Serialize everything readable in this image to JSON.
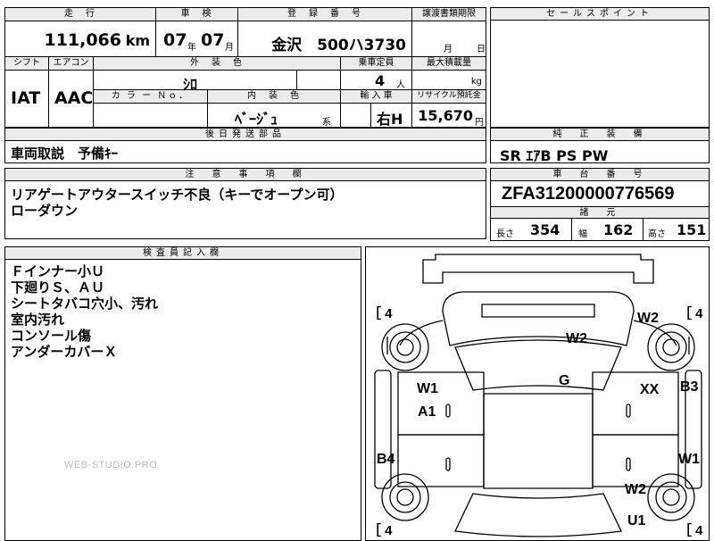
{
  "top_partial": "（上部切れ）",
  "spec": {
    "headers": {
      "mileage": "走　行",
      "inspection": "車　検",
      "registration": "登　録　番　号",
      "transfer_deadline": "譲渡書類期限",
      "shift": "シフト",
      "aircon": "エアコン",
      "exterior_color": "外　装　色",
      "capacity": "乗車定員",
      "max_load": "最大積載量",
      "color_no": "カ ラ ー Ｎｏ．",
      "interior_color": "内　装　色",
      "import": "輸 入 車",
      "recycle": "リサイクル預託金"
    },
    "mileage_value": "111,066",
    "mileage_unit": "km",
    "inspection_year": "07",
    "inspection_year_unit": "年",
    "inspection_month": "07",
    "inspection_month_unit": "月",
    "registration_value": "金沢　500ハ3730",
    "deadline_month_unit": "月",
    "deadline_day_unit": "日",
    "shift_value": "IAT",
    "aircon_value": "AAC",
    "exterior_color_value": "ｼﾛ",
    "capacity_value": "4",
    "capacity_unit": "人",
    "max_load_unit": "kg",
    "interior_color_value": "ﾍﾞｰｼﾞｭ",
    "interior_color_suffix": "系",
    "import_value": "右H",
    "recycle_value": "15,670",
    "recycle_unit": "円"
  },
  "sales_point": {
    "title": "セールスポイント"
  },
  "equipment": {
    "title": "純　正　装　備",
    "value": "SR  ｴｱB  PS  PW"
  },
  "later_parts": {
    "title": "後日発送部品",
    "value": "車両取説　予備ｷｰ"
  },
  "caution": {
    "title": "注　意　事　項　欄",
    "lines": [
      "リアゲートアウタースイッチ不良（キーでオープン可）",
      "ローダウン"
    ]
  },
  "chassis": {
    "title": "車　台　番　号",
    "value": "ZFA31200000776569"
  },
  "dimensions": {
    "title": "諸　元",
    "length_label": "長さ",
    "length_value": "354",
    "width_label": "幅",
    "width_value": "162",
    "height_label": "高さ",
    "height_value": "151"
  },
  "inspector": {
    "title": "検査員記入欄",
    "lines": [
      "Ｆインナー小Ｕ",
      "下廻りＳ、ＡＵ",
      "シートタバコ穴小、汚れ",
      "室内汚れ",
      "コンソール傷",
      "アンダーカバーＸ"
    ]
  },
  "diagram": {
    "marks": {
      "bracket_tl": "［ 4",
      "bracket_tr": "［ 4",
      "bracket_bl": "［ 4",
      "bracket_br": "［ 4",
      "w2_top_right": "W2",
      "w2_roof": "W2",
      "g": "G",
      "w1_left": "W1",
      "a1": "A1",
      "xx": "XX",
      "b3": "B3",
      "b4": "B4",
      "w1_right": "W1",
      "w2_bottom_right": "W2",
      "u1": "U1"
    }
  },
  "watermark": "WEB-STUDIO.PRO"
}
